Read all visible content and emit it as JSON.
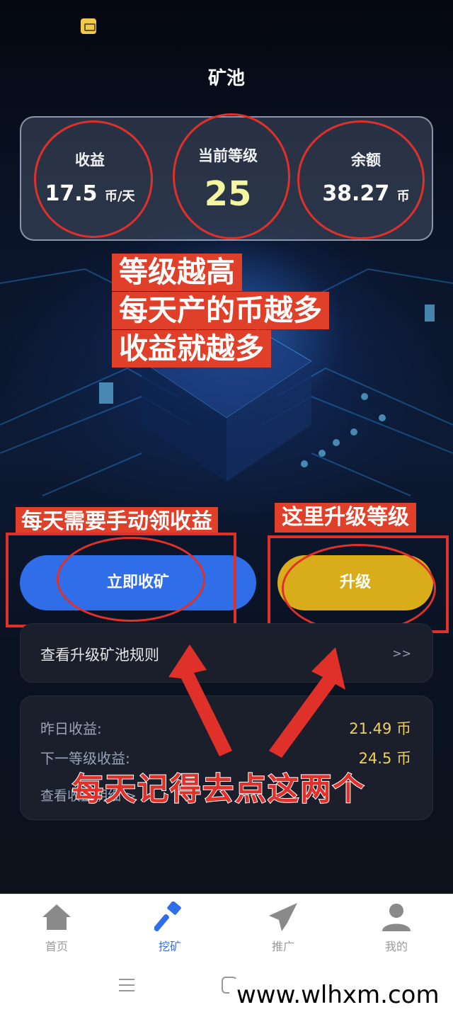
{
  "header": {
    "title": "矿池"
  },
  "stats": {
    "income": {
      "label": "收益",
      "value": "17.5",
      "unit": "币/天"
    },
    "level": {
      "label": "当前等级",
      "value": "25"
    },
    "balance": {
      "label": "余额",
      "value": "38.27",
      "unit": "币"
    }
  },
  "annotations": {
    "level_note": [
      "等级越高",
      "每天产的币越多",
      "收益就越多"
    ],
    "manual_claim_note": "每天需要手动领收益",
    "upgrade_note": "这里升级等级",
    "daily_reminder": "每天记得去点这两个"
  },
  "actions": {
    "mine_label": "立即收矿",
    "upgrade_label": "升级"
  },
  "rules": {
    "label": "查看升级矿池规则",
    "arrow": ">>"
  },
  "income_panel": {
    "yesterday_label": "昨日收益:",
    "yesterday_value": "21.49 币",
    "next_level_label": "下一等级收益:",
    "next_level_value": "24.5 币",
    "detail_link": "查看收益明细 >"
  },
  "tabbar": {
    "tabs": [
      {
        "label": "首页",
        "icon": "home-icon"
      },
      {
        "label": "挖矿",
        "icon": "hammer-icon"
      },
      {
        "label": "推广",
        "icon": "paper-plane-icon"
      },
      {
        "label": "我的",
        "icon": "user-icon"
      }
    ]
  },
  "watermark": "www.wlhxm.com",
  "colors": {
    "accent_blue": "#2f6ee8",
    "upgrade_gold": "#d9ad1a",
    "annotation_red": "#e0302a",
    "value_gold": "#f0d060"
  }
}
